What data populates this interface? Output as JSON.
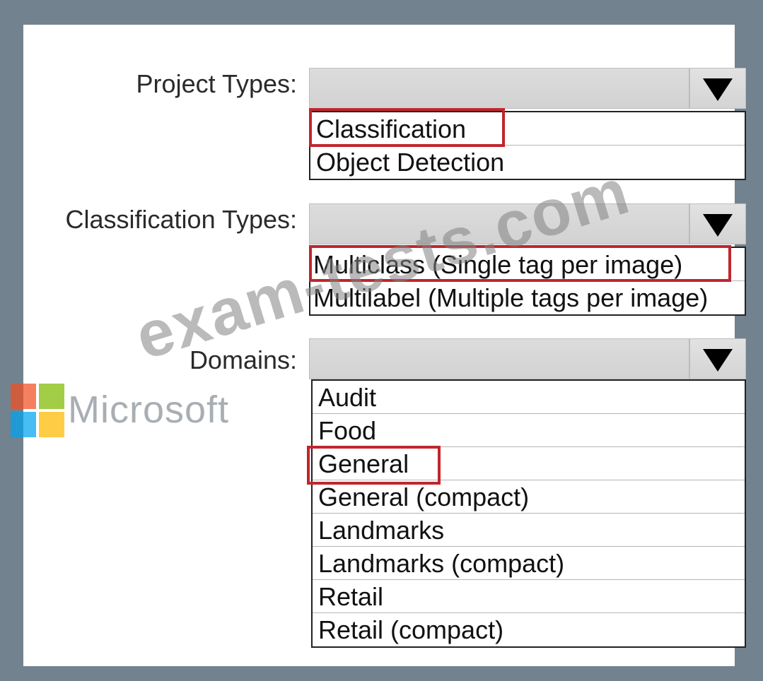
{
  "project_types": {
    "label": "Project Types:",
    "options": [
      "Classification",
      "Object Detection"
    ],
    "highlighted": "Classification"
  },
  "classification_types": {
    "label": "Classification Types:",
    "options": [
      "Multiclass (Single tag per image)",
      "Multilabel (Multiple tags per image)"
    ],
    "highlighted": "Multiclass (Single tag per image)"
  },
  "domains": {
    "label": "Domains:",
    "options": [
      "Audit",
      "Food",
      "General",
      "General (compact)",
      "Landmarks",
      "Landmarks (compact)",
      "Retail",
      "Retail (compact)"
    ],
    "highlighted": "General"
  },
  "branding": {
    "text": "Microsoft",
    "watermark": "exam-tests.com",
    "logo_colors": [
      "#f25022",
      "#7fba00",
      "#00a4ef",
      "#ffb900"
    ]
  },
  "colors": {
    "frame": "#72828f",
    "highlight_border": "#c0262c",
    "dropdown_fill": "#d6d6d6"
  },
  "icons": {
    "dropdown_arrow": "triangle-down-icon"
  }
}
